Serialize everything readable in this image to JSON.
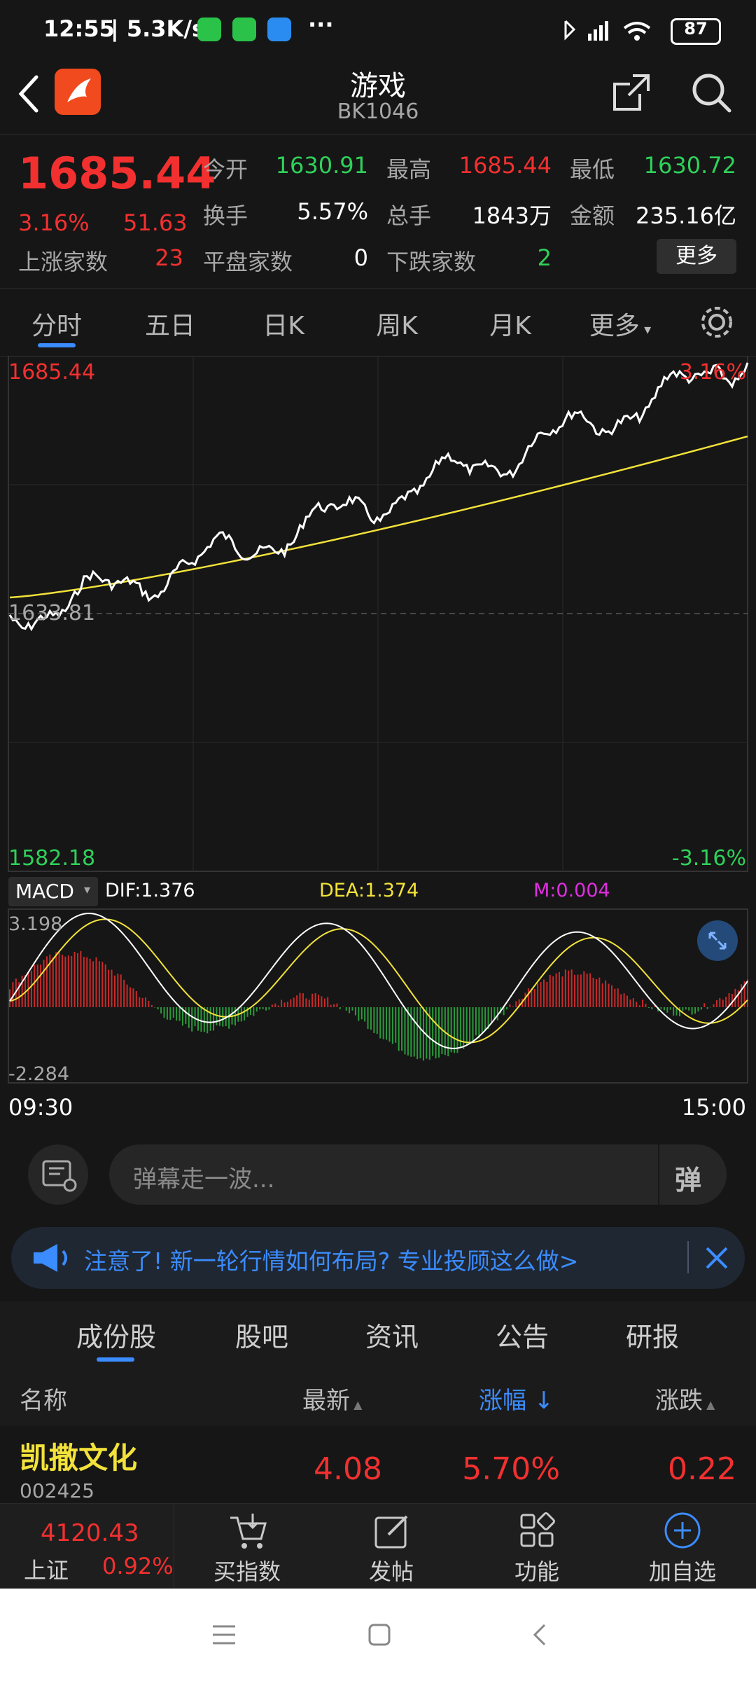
{
  "status_bar": {
    "time": "12:55",
    "speed": "| 5.3K/s",
    "more": "···",
    "battery": "87"
  },
  "header": {
    "title": "游戏",
    "code": "BK1046"
  },
  "quote": {
    "price": "1685.44",
    "change_pct": "3.16%",
    "change": "51.63",
    "open_label": "今开",
    "open": "1630.91",
    "high_label": "最高",
    "high": "1685.44",
    "low_label": "最低",
    "low": "1630.72",
    "turnover_label": "换手",
    "turnover": "5.57%",
    "volume_label": "总手",
    "volume": "1843万",
    "amount_label": "金额",
    "amount": "235.16亿",
    "up_label": "上涨家数",
    "up": "23",
    "flat_label": "平盘家数",
    "flat": "0",
    "down_label": "下跌家数",
    "down": "2",
    "more_button": "更多"
  },
  "period_tabs": [
    "分时",
    "五日",
    "日K",
    "周K",
    "月K",
    "更多"
  ],
  "chart": {
    "y_top": "1685.44",
    "y_top_pct": "3.16%",
    "y_mid": "1633.81",
    "y_bottom": "1582.18",
    "y_bottom_pct": "-3.16%",
    "x_start": "09:30",
    "x_end": "15:00",
    "indicator": "MACD",
    "dif": "DIF:1.376",
    "dea": "DEA:1.374",
    "m": "M:0.004",
    "macd_top": "3.198",
    "macd_bottom": "-2.284",
    "colors": {
      "price": "#ffffff",
      "avg": "#f2e23a",
      "up": "#c92a2a",
      "down": "#2a9a3a"
    }
  },
  "danmu": {
    "placeholder": "弹幕走一波...",
    "send_label": "弹"
  },
  "notice": {
    "text": "注意了! 新一轮行情如何布局? 专业投顾这么做>"
  },
  "sub_tabs": [
    "成份股",
    "股吧",
    "资讯",
    "公告",
    "研报"
  ],
  "table": {
    "col_name": "名称",
    "col_latest": "最新",
    "col_pct": "涨幅",
    "col_change": "涨跌",
    "rows": [
      {
        "name": "凯撒文化",
        "code": "002425",
        "latest": "4.08",
        "pct": "5.70%",
        "change": "0.22"
      }
    ]
  },
  "bottom_bar": {
    "index_value": "4120.43",
    "index_name": "上证",
    "index_pct": "0.92%",
    "items": [
      "买指数",
      "发帖",
      "功能",
      "加自选"
    ]
  }
}
